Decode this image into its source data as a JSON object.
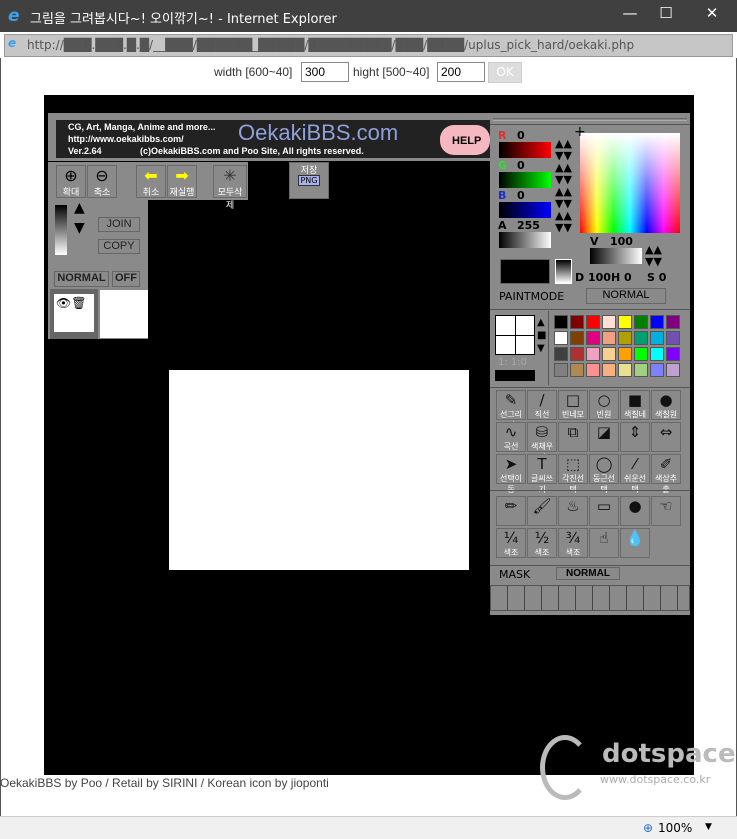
{
  "window": {
    "title": "그림을 그려봅시다~! 오이깎기~! - Internet Explorer",
    "minimize": "—",
    "maximize": "☐",
    "close": "✕"
  },
  "address": {
    "url": "http://███.███.█.█/__███/██████_█████/█████████/███/████/uplus_pick_hard/oekaki.php"
  },
  "size_form": {
    "width_label": "width [600~40]",
    "width_value": "300",
    "height_label": "hight [500~40]",
    "height_value": "200",
    "ok": "OK"
  },
  "banner": {
    "line1": "CG, Art, Manga, Anime and more...",
    "line2": "http://www.oekakibbs.com/",
    "version": "Ver.2.64",
    "copyright": "(c)OekakiBBS.com and Poo Site, All rights reserved.",
    "logo": "OekakiBBS.com",
    "help": "HELP"
  },
  "toolbar": {
    "zoom_in": "확대",
    "zoom_out": "축소",
    "undo": "취소",
    "redo": "재실행",
    "clear": "모두삭제",
    "save": "저장",
    "png": "PNG"
  },
  "layers": {
    "join": "JOIN",
    "copy": "COPY",
    "mode": "NORMAL",
    "off": "OFF"
  },
  "color": {
    "r_label": "R",
    "r": "0",
    "g_label": "G",
    "g": "0",
    "b_label": "B",
    "b": "0",
    "a_label": "A",
    "a": "255",
    "v_label": "V",
    "v": "100",
    "d_label": "D",
    "d": "100",
    "h_label": "H",
    "h": "0",
    "s_label": "S",
    "s": "0",
    "paintmode_label": "PAINTMODE",
    "paintmode": "NORMAL",
    "current": "#000000"
  },
  "pen_size": {
    "ratio": "1: 1:0"
  },
  "palette": [
    "#000000",
    "#800000",
    "#ff0000",
    "#ffe0d4",
    "#ffff00",
    "#008000",
    "#0000ff",
    "#800080",
    "#ffffff",
    "#804000",
    "#e0007f",
    "#f0a080",
    "#b0a000",
    "#00a070",
    "#00b0e0",
    "#7050b0",
    "#404040",
    "#b03030",
    "#f0a0c0",
    "#f8d090",
    "#ffa000",
    "#00ff00",
    "#00ffff",
    "#8000ff",
    "#808080",
    "#b08850",
    "#ff9090",
    "#f8b080",
    "#e8e090",
    "#a0d080",
    "#8080ff",
    "#c0a0d0"
  ],
  "tools": [
    {
      "label": "선그리기",
      "icon": "✎"
    },
    {
      "label": "직선",
      "icon": "∕"
    },
    {
      "label": "빈네모",
      "icon": "□"
    },
    {
      "label": "빈원",
      "icon": "○"
    },
    {
      "label": "색칠네모",
      "icon": "■"
    },
    {
      "label": "색칠원",
      "icon": "●"
    },
    {
      "label": "곡선",
      "icon": "∿"
    },
    {
      "label": "색채우기",
      "icon": "⛁"
    },
    {
      "label": "",
      "icon": "⧉"
    },
    {
      "label": "",
      "icon": "◪"
    },
    {
      "label": "",
      "icon": "⇕"
    },
    {
      "label": "",
      "icon": "⇔"
    },
    {
      "label": "선택이동",
      "icon": "➤"
    },
    {
      "label": "글씨쓰기",
      "icon": "T"
    },
    {
      "label": "각진선택",
      "icon": "⬚"
    },
    {
      "label": "둥근선택",
      "icon": "◯"
    },
    {
      "label": "쉬운선택",
      "icon": "⁄"
    },
    {
      "label": "색상추출",
      "icon": "✐"
    }
  ],
  "brushes": [
    {
      "label": "",
      "icon": "✏"
    },
    {
      "label": "",
      "icon": "🖌"
    },
    {
      "label": "",
      "icon": "♨"
    },
    {
      "label": "",
      "icon": "▭"
    },
    {
      "label": "",
      "icon": "●"
    },
    {
      "label": "",
      "icon": "☜"
    },
    {
      "label": "색조",
      "icon": "¼"
    },
    {
      "label": "색조",
      "icon": "½"
    },
    {
      "label": "색조",
      "icon": "¾"
    },
    {
      "label": "",
      "icon": "☝"
    },
    {
      "label": "",
      "icon": "💧"
    }
  ],
  "mask": {
    "label": "MASK",
    "mode": "NORMAL"
  },
  "footer": "OekakiBBS by Poo / Retail by SIRINI / Korean icon by jioponti",
  "watermark": {
    "name": "dotspace",
    "url": "www.dotspace.co.kr"
  },
  "status": {
    "zoom": "100%"
  }
}
